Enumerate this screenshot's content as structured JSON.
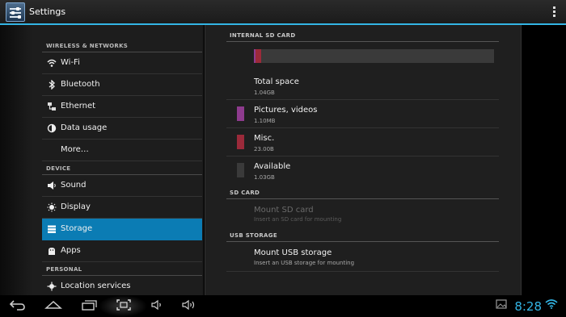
{
  "app": {
    "title": "Settings"
  },
  "sidebar": {
    "headers": {
      "wireless": "WIRELESS & NETWORKS",
      "device": "DEVICE",
      "personal": "PERSONAL"
    },
    "items": [
      {
        "label": "Wi-Fi",
        "icon": "wifi-icon"
      },
      {
        "label": "Bluetooth",
        "icon": "bluetooth-icon"
      },
      {
        "label": "Ethernet",
        "icon": "ethernet-icon"
      },
      {
        "label": "Data usage",
        "icon": "data-usage-icon"
      },
      {
        "label": "More…",
        "icon": ""
      },
      {
        "label": "Sound",
        "icon": "sound-icon"
      },
      {
        "label": "Display",
        "icon": "display-icon"
      },
      {
        "label": "Storage",
        "icon": "storage-icon",
        "selected": true
      },
      {
        "label": "Apps",
        "icon": "apps-icon"
      },
      {
        "label": "Location services",
        "icon": "location-icon"
      }
    ]
  },
  "storage": {
    "internal": {
      "header": "INTERNAL SD CARD",
      "usage_bar": [
        {
          "name": "Pictures, videos",
          "fraction": 0.0011,
          "color": "#8e3b8e"
        },
        {
          "name": "Misc.",
          "fraction": 0.0221,
          "color": "#9b2a3a"
        },
        {
          "name": "Available",
          "fraction": 0.9768,
          "color": "#3a3a3a"
        }
      ],
      "total": {
        "title": "Total space",
        "value": "1.04GB"
      },
      "pictures": {
        "title": "Pictures, videos",
        "value": "1.10MB",
        "color": "#8e3b8e"
      },
      "misc": {
        "title": "Misc.",
        "value": "23.00B",
        "color": "#9b2a3a"
      },
      "available": {
        "title": "Available",
        "value": "1.03GB",
        "color": "#3a3a3a"
      }
    },
    "sdcard": {
      "header": "SD CARD",
      "mount": {
        "title": "Mount SD card",
        "summary": "Insert an SD card for mounting"
      }
    },
    "usb": {
      "header": "USB STORAGE",
      "mount": {
        "title": "Mount USB storage",
        "summary": "Insert an USB storage for mounting"
      }
    }
  },
  "navbar": {
    "clock": "8:28",
    "accent": "#33b5e5"
  }
}
